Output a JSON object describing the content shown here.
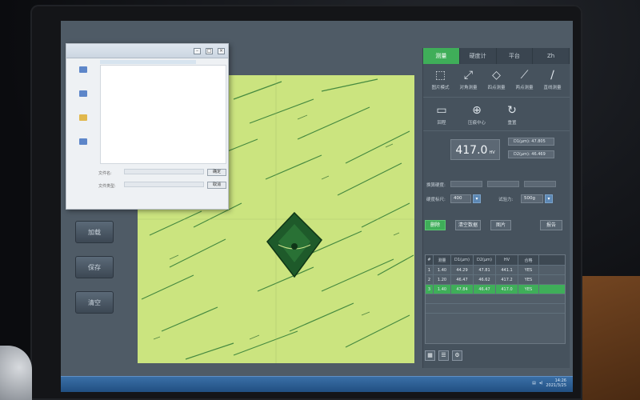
{
  "panel": {
    "tabs": [
      {
        "label": "测量",
        "active": true
      },
      {
        "label": "硬度计",
        "active": false
      },
      {
        "label": "平台",
        "active": false
      },
      {
        "label": "Zh",
        "active": false
      }
    ],
    "tools_row1": [
      {
        "icon": "box-select-icon",
        "glyph": "⬚",
        "label": "图片模式"
      },
      {
        "icon": "axis-measure-icon",
        "glyph": "⤢",
        "label": "对角测量"
      },
      {
        "icon": "diamond-measure-icon",
        "glyph": "◇",
        "label": "四点测量"
      },
      {
        "icon": "two-point-measure-icon",
        "glyph": "⟋",
        "label": "两点测量"
      },
      {
        "icon": "line-measure-icon",
        "glyph": "∕",
        "label": "直线测量"
      }
    ],
    "tools_row2": [
      {
        "icon": "monitor-icon",
        "glyph": "▭",
        "label": "回程"
      },
      {
        "icon": "target-center-icon",
        "glyph": "⊕",
        "label": "压痕中心"
      },
      {
        "icon": "refresh-icon",
        "glyph": "↻",
        "label": "重置"
      }
    ],
    "readout": {
      "hardness_value": "417.0",
      "hardness_unit": "HV",
      "d1": "D1(μm): 47.805",
      "d2": "D2(μm): 46.469"
    },
    "params": {
      "hardness_label": "硬度标尺:",
      "hardness_select": "400",
      "test_force_label": "试验力:",
      "test_force_select": "500g",
      "conversion_label": "换算硬度:"
    },
    "actions": {
      "save": "删除",
      "clear": "清空数据",
      "export": "图片",
      "report": "报告"
    },
    "table": {
      "headers": [
        "#",
        "测量",
        "D1(μm)",
        "D2(μm)",
        "HV",
        "合格"
      ],
      "rows": [
        {
          "marker": "",
          "cells": [
            "1",
            "1.40",
            "44.29",
            "47.81",
            "441.1",
            "YES"
          ],
          "selected": false
        },
        {
          "marker": "",
          "cells": [
            "2",
            "1.20",
            "46.47",
            "46.62",
            "417.2",
            "YES"
          ],
          "selected": false
        },
        {
          "marker": "▸",
          "cells": [
            "3",
            "1.40",
            "47.84",
            "46.47",
            "417.0",
            "YES"
          ],
          "selected": true
        }
      ]
    },
    "bottom_tools": [
      {
        "icon": "calculator-icon",
        "glyph": "▦"
      },
      {
        "icon": "list-icon",
        "glyph": "☰"
      },
      {
        "icon": "settings-icon",
        "glyph": "⚙"
      }
    ]
  },
  "left_rail": [
    "加载",
    "保存",
    "清空"
  ],
  "dialog": {
    "ok_button": "确定",
    "cancel_button": "取消",
    "filename_label": "文件名:",
    "filetype_label": "文件类型:"
  },
  "taskbar": {
    "time": "14:26",
    "date": "2021/3/25"
  },
  "colors": {
    "accent_green": "#3fae59",
    "panel_bg": "#46525d",
    "scope_bg": "#c7e27a"
  }
}
